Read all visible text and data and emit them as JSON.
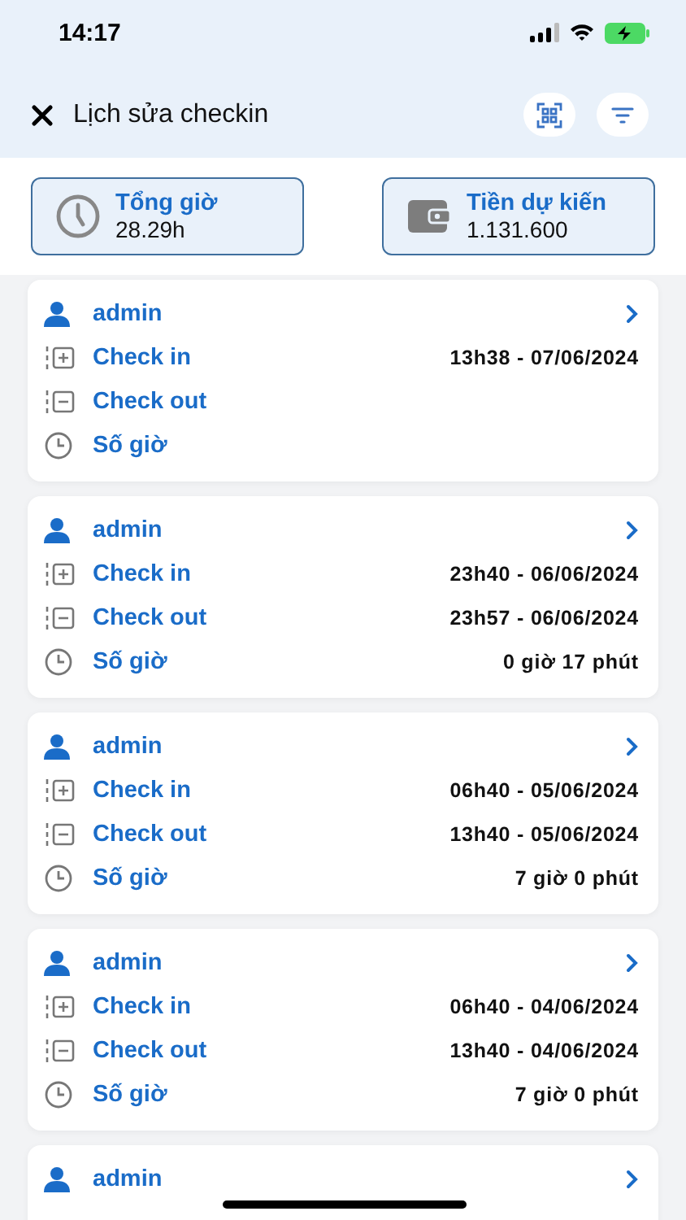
{
  "status_bar": {
    "time": "14:17"
  },
  "header": {
    "title": "Lịch sửa checkin"
  },
  "summary": [
    {
      "kind": "clock",
      "label": "Tổng giờ",
      "value": "28.29h"
    },
    {
      "kind": "wallet",
      "label": "Tiền dự kiến",
      "value": "1.131.600"
    }
  ],
  "records": [
    {
      "user": "admin",
      "rows": [
        {
          "kind": "in",
          "label": "Check in",
          "value": "13h38 - 07/06/2024"
        },
        {
          "kind": "out",
          "label": "Check out"
        },
        {
          "kind": "hours",
          "label": "Số giờ"
        }
      ]
    },
    {
      "user": "admin",
      "rows": [
        {
          "kind": "in",
          "label": "Check in",
          "value": "23h40 - 06/06/2024"
        },
        {
          "kind": "out",
          "label": "Check out",
          "value": "23h57 - 06/06/2024"
        },
        {
          "kind": "hours",
          "label": "Số giờ",
          "value": "0 giờ 17 phút"
        }
      ]
    },
    {
      "user": "admin",
      "rows": [
        {
          "kind": "in",
          "label": "Check in",
          "value": "06h40 - 05/06/2024"
        },
        {
          "kind": "out",
          "label": "Check out",
          "value": "13h40 - 05/06/2024"
        },
        {
          "kind": "hours",
          "label": "Số giờ",
          "value": "7 giờ 0 phút"
        }
      ]
    },
    {
      "user": "admin",
      "rows": [
        {
          "kind": "in",
          "label": "Check in",
          "value": "06h40 - 04/06/2024"
        },
        {
          "kind": "out",
          "label": "Check out",
          "value": "13h40 - 04/06/2024"
        },
        {
          "kind": "hours",
          "label": "Số giờ",
          "value": "7 giờ 0 phút"
        }
      ]
    },
    {
      "user": "admin"
    }
  ]
}
